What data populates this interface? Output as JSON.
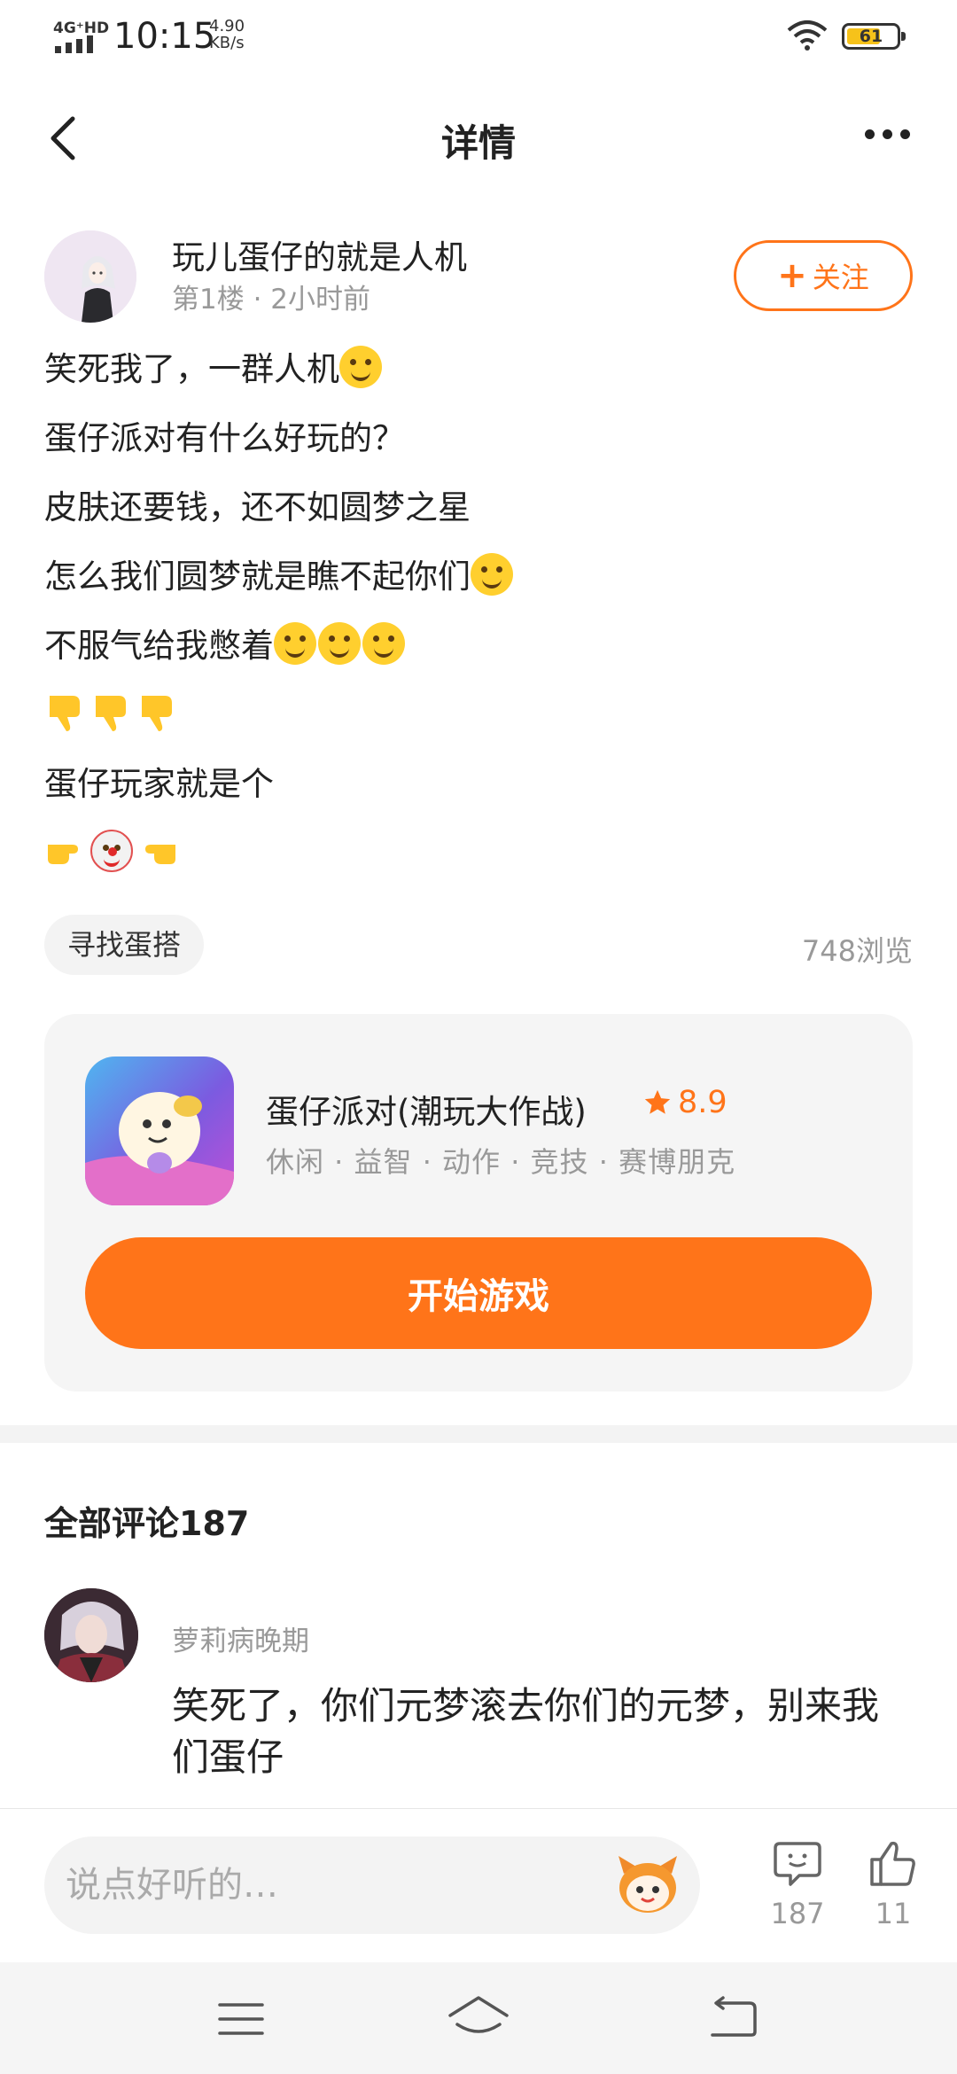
{
  "status_bar": {
    "network": "4G⁺HD",
    "time": "10:15",
    "speed_value": "4.90",
    "speed_unit": "KB/s",
    "battery": "61",
    "battery_color": "#f6c21a"
  },
  "header": {
    "title": "详情"
  },
  "post": {
    "author_name": "玩儿蛋仔的就是人机",
    "author_meta": "第1楼 · 2小时前",
    "follow_label": "关注",
    "lines": [
      "笑死我了，一群人机",
      "蛋仔派对有什么好玩的？",
      "皮肤还要钱，还不如圆梦之星",
      "怎么我们圆梦就是瞧不起你们",
      "不服气给我憋着",
      "",
      "蛋仔玩家就是个",
      ""
    ],
    "tag": "寻找蛋搭",
    "views": "748浏览"
  },
  "game": {
    "name": "蛋仔派对(潮玩大作战)",
    "rating": "8.9",
    "tags": "休闲 · 益智 · 动作 · 竞技 · 赛博朋克",
    "play_label": "开始游戏"
  },
  "comments": {
    "title": "全部评论187",
    "items": [
      {
        "author": "萝莉病晚期",
        "text": "笑死了，你们元梦滚去你们的元梦，别来我们蛋仔"
      }
    ]
  },
  "bottom_bar": {
    "input_placeholder": "说点好听的…",
    "comment_count": "187",
    "like_count": "11"
  },
  "colors": {
    "accent": "#ff7419",
    "muted_text": "#999999",
    "card_bg": "#f5f5f5"
  },
  "icons": [
    "back-icon",
    "more-icon",
    "plus-icon",
    "star-icon",
    "comment-icon",
    "like-icon",
    "menu-icon",
    "home-icon",
    "return-icon",
    "wifi-icon",
    "signal-icon",
    "mascot-icon"
  ]
}
